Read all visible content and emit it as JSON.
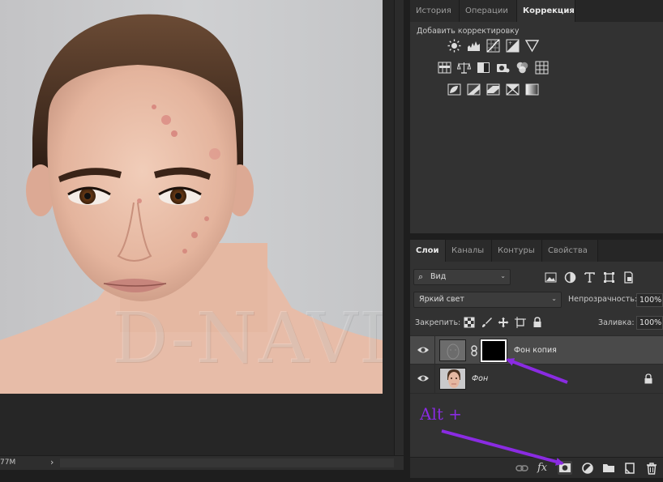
{
  "canvas": {
    "watermark": "D-NAVI",
    "status_text": "77M",
    "status_arrow": "›"
  },
  "correction_panel": {
    "tabs": [
      {
        "label": "История",
        "active": false
      },
      {
        "label": "Операции",
        "active": false
      },
      {
        "label": "Коррекция",
        "active": true
      }
    ],
    "add_label": "Добавить корректировку",
    "icon_rows": [
      [
        "brightness-contrast-icon",
        "levels-icon",
        "curves-icon",
        "exposure-icon",
        "gradient-triangle-icon"
      ],
      [
        "vibrance-icon",
        "color-balance-icon",
        "black-white-icon",
        "photo-filter-icon",
        "channel-mixer-icon",
        "color-lookup-icon"
      ],
      [
        "invert-icon",
        "posterize-icon",
        "threshold-icon",
        "selective-color-icon",
        "gradient-map-icon"
      ]
    ]
  },
  "layers_panel": {
    "tabs": [
      {
        "label": "Слои",
        "active": true
      },
      {
        "label": "Каналы",
        "active": false
      },
      {
        "label": "Контуры",
        "active": false
      },
      {
        "label": "Свойства",
        "active": false
      }
    ],
    "filter_kind": "Вид",
    "blend_mode": "Яркий свет",
    "opacity_label": "Непрозрачность:",
    "opacity_value": "100%",
    "lock_label": "Закрепить:",
    "fill_label": "Заливка:",
    "fill_value": "100%",
    "layers": [
      {
        "name": "Фон копия",
        "selected": true,
        "has_mask": true,
        "locked": false
      },
      {
        "name": "Фон",
        "selected": false,
        "has_mask": false,
        "locked": true
      }
    ],
    "footer_icons": [
      "link-layers-icon",
      "fx-icon",
      "add-mask-icon",
      "adjustment-layer-icon",
      "new-group-icon",
      "new-layer-icon",
      "delete-layer-icon"
    ],
    "fx_label": "fx"
  },
  "annotation": {
    "text": "Alt +",
    "color": "#8a2be2"
  }
}
